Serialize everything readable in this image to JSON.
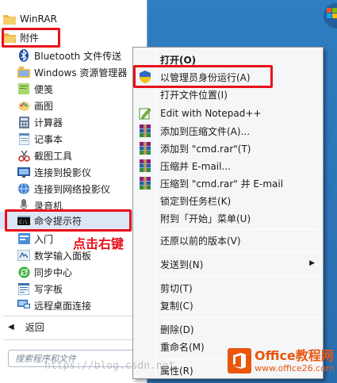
{
  "start_menu": {
    "folders": [
      {
        "label": "WinRAR"
      },
      {
        "label": "附件"
      }
    ],
    "items": [
      {
        "label": "Bluetooth 文件传送",
        "icon": "bluetooth-icon"
      },
      {
        "label": "Windows 资源管理器",
        "icon": "explorer-icon"
      },
      {
        "label": "便笺",
        "icon": "sticky-notes-icon"
      },
      {
        "label": "画图",
        "icon": "paint-icon"
      },
      {
        "label": "计算器",
        "icon": "calculator-icon"
      },
      {
        "label": "记事本",
        "icon": "notepad-icon"
      },
      {
        "label": "截图工具",
        "icon": "snipping-tool-icon"
      },
      {
        "label": "连接到投影仪",
        "icon": "projector-icon"
      },
      {
        "label": "连接到网络投影仪",
        "icon": "network-projector-icon"
      },
      {
        "label": "录音机",
        "icon": "sound-recorder-icon"
      },
      {
        "label": "命令提示符",
        "icon": "cmd-icon"
      },
      {
        "label": "入门",
        "icon": "getting-started-icon"
      },
      {
        "label": "数学输入面板",
        "icon": "math-input-icon"
      },
      {
        "label": "同步中心",
        "icon": "sync-center-icon"
      },
      {
        "label": "写字板",
        "icon": "wordpad-icon"
      },
      {
        "label": "远程桌面连接",
        "icon": "remote-desktop-icon"
      }
    ],
    "back_label": "返回",
    "search_placeholder": "搜索程序和文件"
  },
  "annotation": {
    "text": "点击右键",
    "color": "#e8101a"
  },
  "context_menu": {
    "groups": [
      [
        {
          "label": "打开(O)",
          "bold": true
        },
        {
          "label": "以管理员身份运行(A)",
          "icon": "uac-shield-icon",
          "highlighted": true
        },
        {
          "label": "打开文件位置(I)"
        },
        {
          "label": "Edit with Notepad++",
          "icon": "notepadpp-icon"
        },
        {
          "label": "添加到压缩文件(A)...",
          "icon": "winrar-icon"
        },
        {
          "label": "添加到 \"cmd.rar\"(T)",
          "icon": "winrar-icon"
        },
        {
          "label": "压缩并 E-mail...",
          "icon": "winrar-icon"
        },
        {
          "label": "压缩到 \"cmd.rar\" 并 E-mail",
          "icon": "winrar-icon"
        },
        {
          "label": "锁定到任务栏(K)"
        },
        {
          "label": "附到「开始」菜单(U)"
        }
      ],
      [
        {
          "label": "还原以前的版本(V)"
        }
      ],
      [
        {
          "label": "发送到(N)",
          "submenu": true
        }
      ],
      [
        {
          "label": "剪切(T)"
        },
        {
          "label": "复制(C)"
        }
      ],
      [
        {
          "label": "删除(D)"
        },
        {
          "label": "重命名(M)"
        }
      ],
      [
        {
          "label": "属性(R)"
        }
      ]
    ]
  },
  "watermark": {
    "url_text": "https://blog.csdn.net",
    "brand_line1": "Office教程网",
    "brand_line2": "www.office26.com"
  },
  "colors": {
    "accent": "#e8101a",
    "selection": "#dbe7f6",
    "brand": "#e9560e"
  }
}
